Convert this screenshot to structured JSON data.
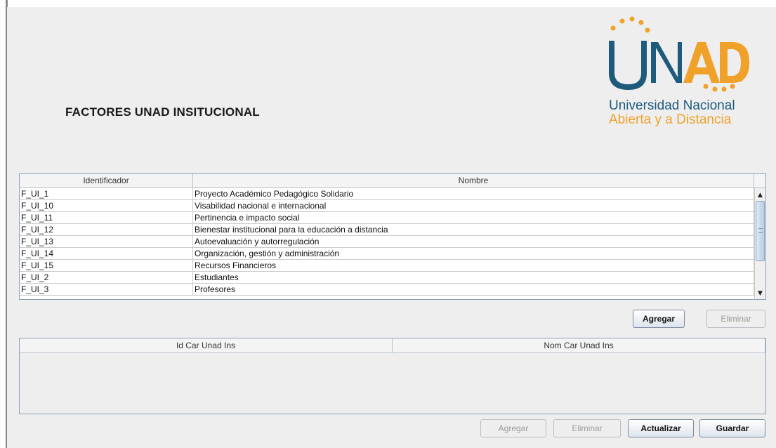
{
  "window": {
    "title": "FACTORES UNAD INSITUCIONAL"
  },
  "logo": {
    "text": "UNAD",
    "line1": "Universidad Nacional",
    "line2": "Abierta y a  Distancia"
  },
  "factors_table": {
    "columns": [
      "Identificador",
      "Nombre"
    ],
    "rows": [
      {
        "id": "F_UI_1",
        "name": "Proyecto Académico Pedagógico Solidario"
      },
      {
        "id": "F_UI_10",
        "name": "Visabilidad nacional e internacional"
      },
      {
        "id": "F_UI_11",
        "name": "Pertinencia e impacto social"
      },
      {
        "id": "F_UI_12",
        "name": "Bienestar institucional para la educación a distancia"
      },
      {
        "id": "F_UI_13",
        "name": "Autoevaluación y autorregulación"
      },
      {
        "id": "F_UI_14",
        "name": "Organización, gestión y administración"
      },
      {
        "id": "F_UI_15",
        "name": "Recursos Financieros"
      },
      {
        "id": "F_UI_2",
        "name": "Estudiantes"
      },
      {
        "id": "F_UI_3",
        "name": "Profesores"
      }
    ]
  },
  "factors_buttons": {
    "add": "Agregar",
    "delete": "Eliminar"
  },
  "characteristics_table": {
    "columns": [
      "Id Car Unad Ins",
      "Nom Car Unad Ins"
    ]
  },
  "bottom_buttons": {
    "add": "Agregar",
    "delete": "Eliminar",
    "update": "Actualizar",
    "save": "Guardar"
  },
  "colors": {
    "logo_blue": "#1f5a7d",
    "logo_orange": "#f0a12a",
    "panel_bg": "#eeeeee"
  }
}
